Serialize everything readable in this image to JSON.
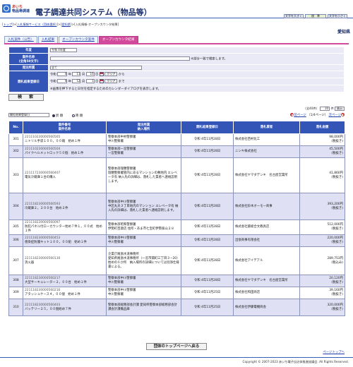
{
  "header": {
    "logo_line1": "あいち",
    "logo_line2": "物品等調達",
    "title": "電子調達共同システム（物品等）",
    "font_large": "文字を大きく",
    "font_std": "標　準",
    "font_small": "文字を小さく"
  },
  "breadcrumb": {
    "items": [
      "トップ",
      "入札情報サービス（団体選択）",
      "愛知県"
    ],
    "current": "入札情報-オープンカウンタ結果"
  },
  "org": "愛知県",
  "tabs": [
    "入札案件（公告）",
    "入札結果",
    "オープンカウンタ案件",
    "オープンカウンタ結果"
  ],
  "form": {
    "year_label": "年度",
    "year_value": "令和 4年度",
    "case_label": "案件名称",
    "case_hint": "(全角50文字)",
    "case_note": "※部分一致で検索します。",
    "dept_label": "発注所属",
    "dept_value": "全て",
    "date_label": "開札結果登録日",
    "date1": {
      "year": "4",
      "month": "11",
      "day": "16"
    },
    "date2": {
      "year": "4",
      "month": "12",
      "day": "1"
    },
    "era": "令和",
    "y": "年",
    "m": "月",
    "d": "日",
    "clear": "クリア",
    "from": "から",
    "to": "まで",
    "date_note": "※画像を押下すると日付を指定するためのカレンダーダイアログを表示します。",
    "search": "検　索"
  },
  "list": {
    "count": "（全40件）",
    "per_page": "10",
    "per_unit": "件",
    "show": "表示",
    "sort_value": "開札結果登録日",
    "asc": "昇 順",
    "desc": "降 順",
    "prev": "前ページ",
    "page_info": "（1/4ページ）",
    "next": "次ページ"
  },
  "columns": {
    "no": "No.",
    "case_no": "案件番号",
    "case_name": "案件名称",
    "dept": "発注所属",
    "place": "納入場所",
    "date": "開札結果登録日",
    "winner": "落札業者",
    "amount": "落札金額"
  },
  "rows": [
    {
      "no": "301",
      "code": "221110230000560565",
      "name": "ニトリル手袋１００，００箱　始め１件",
      "dept": "警察本部中村警察署",
      "place": "中川警察署",
      "date": "令和 4年11月28日",
      "winner": "株式会社西村化工",
      "amount": "98,000円",
      "tax": "(税抜き)"
    },
    {
      "no": "302",
      "code": "221110230000560504",
      "name": "パイクヘルメットロック５０個　始め１件",
      "dept": "警察本部一宮警察署",
      "place": "一宮警察署",
      "date": "令和 4年11月28日",
      "winner": "ニシキ株式会社",
      "amount": "45,500円",
      "tax": "(税抜き)"
    },
    {
      "no": "303",
      "code": "221117230000560407",
      "name": "電気冷蔵庫１台の購入",
      "dept": "警察本部瑞穂警察署",
      "place": "瑞穂警察署管内にあるマンションの敷地内 エレベータ有 納入先の詳細は、落札した業者へ連絡説明します。",
      "date": "令和 4年11月28日",
      "winner": "株式会社ヤマダデンキ　名古屋営業所",
      "amount": "41,860円",
      "tax": "(税抜き)"
    },
    {
      "no": "304",
      "code": "221118230000560593",
      "name": "冷蔵庫２，２００台　始め２件",
      "dept": "警察本部中川警察署",
      "place": "中区丸天３丁目地内のマンション エレベータ有 納入先の詳細は、落札した業者へ連絡説明します。",
      "date": "令和 4年11月28日",
      "winner": "株式会社鈴木オーモー商事",
      "amount": "393,200円",
      "tax": "(税抜き)"
    },
    {
      "no": "305",
      "code": "221118230000560097",
      "name": "防犯パネル付ローカウンター始め７件１，００式　始め１件",
      "dept": "警察本部昭和警察署",
      "place": "伊勢町百貨店 住所・あま市七宝町伊勢家山２８",
      "date": "令和 4年11月28日",
      "winner": "株式会社葵総合文教具店",
      "amount": "512,000円",
      "tax": "(税抜き)"
    },
    {
      "no": "306",
      "code": "221118230000560453",
      "name": "感染症防護キット１００，００組　始め１件",
      "dept": "警察本部中川警察署",
      "place": "中川警察署",
      "date": "令和 4年11月28日",
      "winner": "出張商事有限会社",
      "amount": "220,000円",
      "tax": "(税抜き)"
    },
    {
      "no": "307",
      "code": "221118230000560130",
      "name": "消火器",
      "dept": "企業庁尾張水道事務所",
      "place": "愛知県尾張水道事務所（一宮市関町三丁目３−20）始めの６か所　納入場所の詳細については別添仕様書による。",
      "date": "令和 4年11月28日",
      "winner": "株式会社アイデアル",
      "amount": "289,753円",
      "tax": "(税込み)"
    },
    {
      "no": "308",
      "code": "221118230000560217",
      "name": "大型サーキュレーター２，００台　始め１件",
      "dept": "警察本部中川警察署",
      "place": "中川警察署",
      "date": "令和 4年11月28日",
      "winner": "株式会社ヤマダデンキ　名古屋営業所",
      "amount": "20,120円",
      "tax": "(税抜き)"
    },
    {
      "no": "309",
      "code": "221118230000560216",
      "name": "アタッシュケース４，００個　始め１件",
      "dept": "警察本部中川警察署",
      "place": "中川警察署",
      "date": "令和 4年11月25日",
      "winner": "株式会社和田商店",
      "amount": "39,160円",
      "tax": "(税抜き)"
    },
    {
      "no": "310",
      "code": "221118230000560403",
      "name": "バッテリー２５，００個始め７件",
      "dept": "警察本部総務部会計課 愛知県警察本部総務部会計課会計課備品庫",
      "place": "",
      "date": "令和 4年11月25日",
      "winner": "株式会社伊藤電機商会",
      "amount": "320,000円",
      "tax": "(税抜き)"
    }
  ],
  "top_button": "団体のトップページへ戻る",
  "page_top": "ページトップへ",
  "footer": "Copyright © 2007-2023 あいち電子自治体推進協議会. All Rights Reserved."
}
